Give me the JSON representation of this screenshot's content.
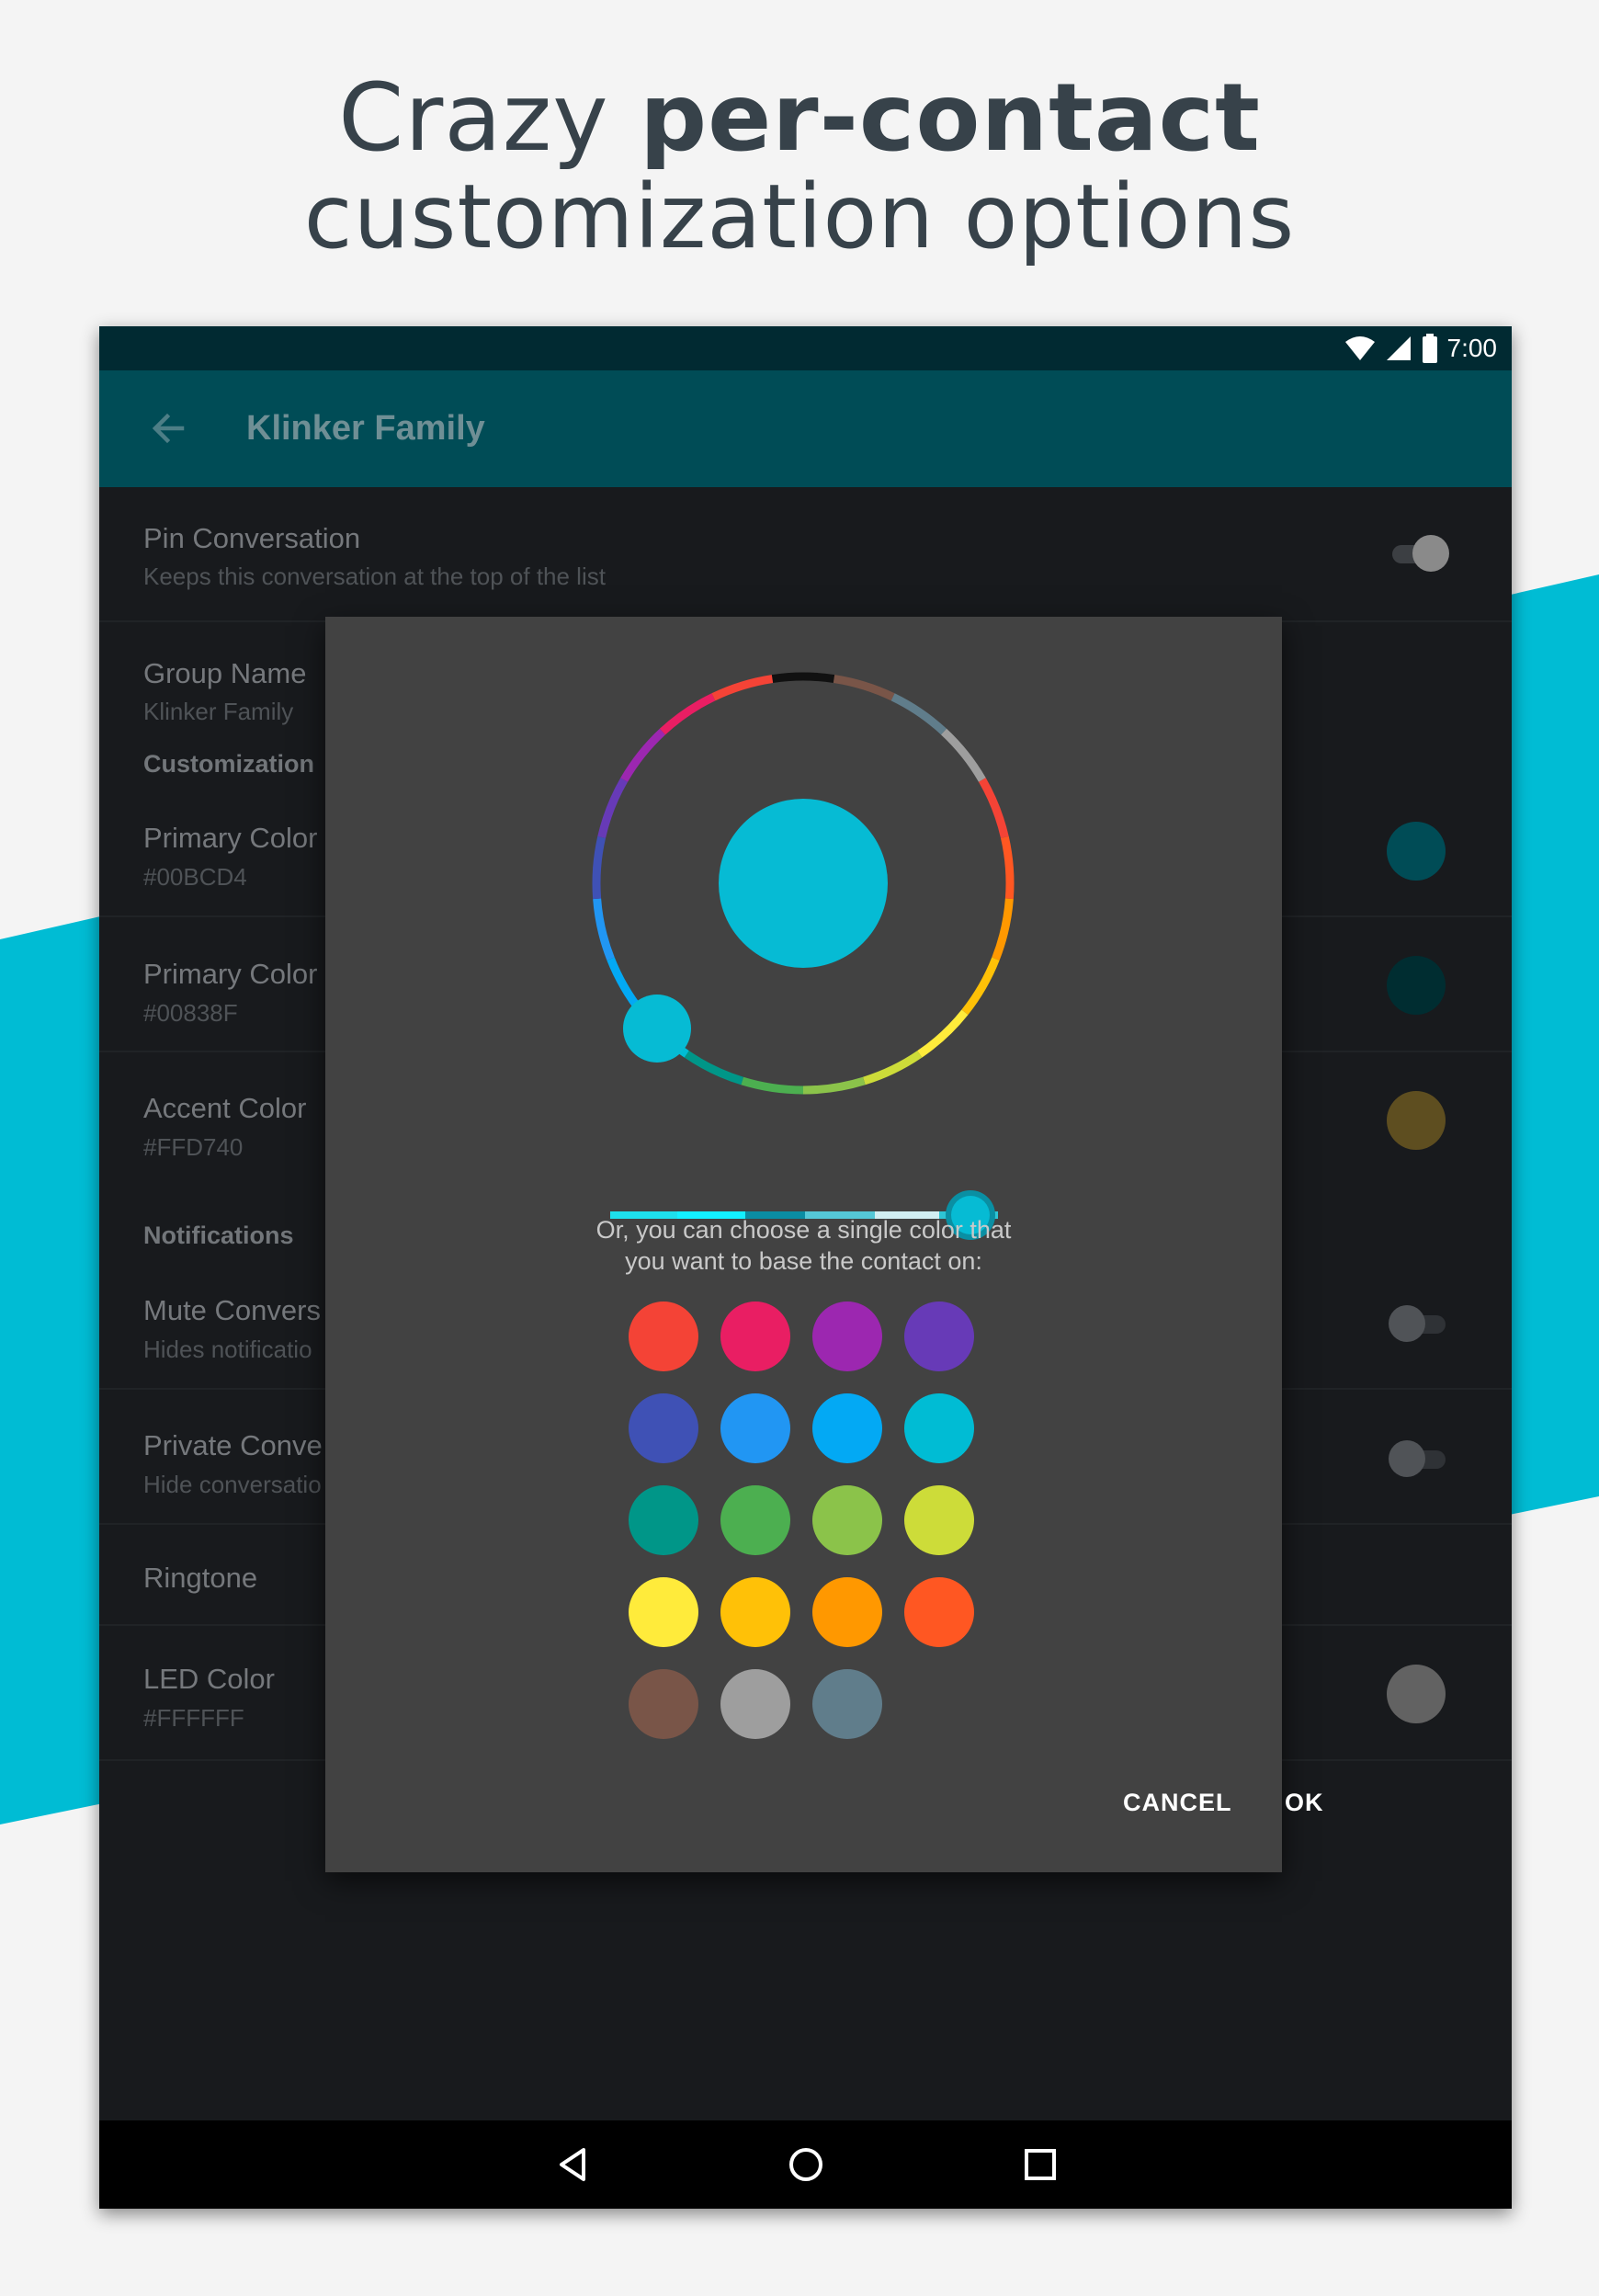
{
  "headline": {
    "line1_prefix": "Crazy ",
    "line1_bold": "per-contact",
    "line2": "customization options"
  },
  "status_bar": {
    "time": "7:00",
    "icons": [
      "wifi-icon",
      "signal-icon",
      "battery-icon"
    ]
  },
  "toolbar": {
    "title": "Klinker Family",
    "back_icon": "arrow-back-icon"
  },
  "settings": {
    "pin": {
      "title": "Pin Conversation",
      "subtitle": "Keeps this conversation at the top of the list"
    },
    "group_name": {
      "title": "Group Name",
      "subtitle": "Klinker Family"
    },
    "customization_header": "Customization",
    "primary_color": {
      "title": "Primary Color",
      "subtitle": "#00BCD4",
      "swatch": "#004c56"
    },
    "primary_color_dark": {
      "title": "Primary Color",
      "subtitle": "#00838F",
      "swatch": "#002d31"
    },
    "accent_color": {
      "title": "Accent Color",
      "subtitle": "#FFD740",
      "swatch": "#5e4e20"
    },
    "notifications_header": "Notifications",
    "mute": {
      "title": "Mute Convers",
      "subtitle": "Hides notificatio"
    },
    "private": {
      "title": "Private Conve",
      "subtitle": "Hide conversatio"
    },
    "ringtone": {
      "title": "Ringtone"
    },
    "led_color": {
      "title": "LED Color",
      "subtitle": "#FFFFFF",
      "swatch": "#626262"
    }
  },
  "dialog": {
    "selected_color": "#06bbd4",
    "text_line1": "Or, you can choose a single color that",
    "text_line2": "you want to base the contact on:",
    "swatches": [
      "#f44336",
      "#e91e63",
      "#9c27b0",
      "#673ab7",
      "#3f51b5",
      "#2196f3",
      "#03a9f4",
      "#00bcd4",
      "#009688",
      "#4caf50",
      "#8bc34a",
      "#cddc39",
      "#ffeb3b",
      "#ffc107",
      "#ff9800",
      "#ff5722",
      "#795548",
      "#9e9e9e",
      "#607d8b"
    ],
    "cancel_label": "CANCEL",
    "ok_label": "OK"
  },
  "nav_bar": {
    "icons": [
      "back-triangle-icon",
      "home-circle-icon",
      "recents-square-icon"
    ]
  },
  "colors": {
    "accent_band": "#00bcd4",
    "toolbar": "#004c56",
    "status_bar": "#012a32"
  }
}
